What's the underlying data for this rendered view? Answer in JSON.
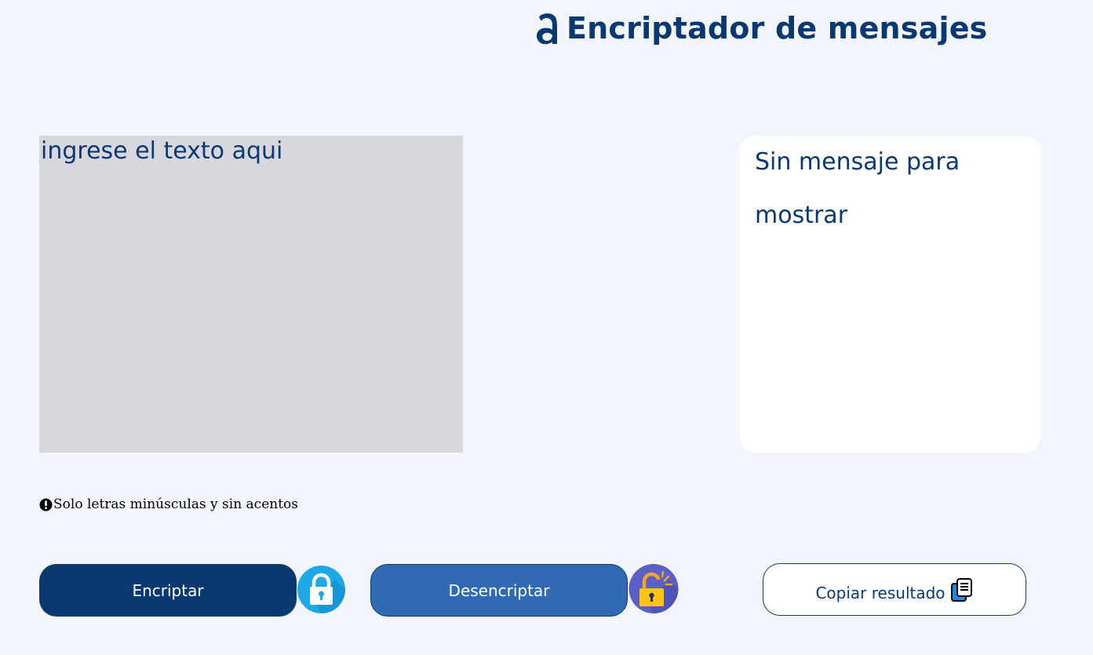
{
  "header": {
    "logo_icon": "alura-logo-icon",
    "title": "Encriptador de mensajes"
  },
  "input": {
    "placeholder": "ingrese el texto aqui",
    "value": ""
  },
  "output": {
    "message": "Sin mensaje para mostrar"
  },
  "hint": {
    "icon": "exclamation-circle-icon",
    "text": "Solo letras minúsculas y sin acentos"
  },
  "buttons": {
    "encrypt_label": "Encriptar",
    "decrypt_label": "Desencriptar",
    "copy_label": "Copiar resultado"
  },
  "icons": {
    "encrypt": "lock-closed-icon",
    "decrypt": "lock-open-icon",
    "copy": "copy-icon"
  },
  "colors": {
    "background": "#F2F5FC",
    "primary": "#0A3871",
    "secondary": "#316AB4",
    "input_bg": "#D8D7DD",
    "panel_bg": "#FFFFFF"
  }
}
